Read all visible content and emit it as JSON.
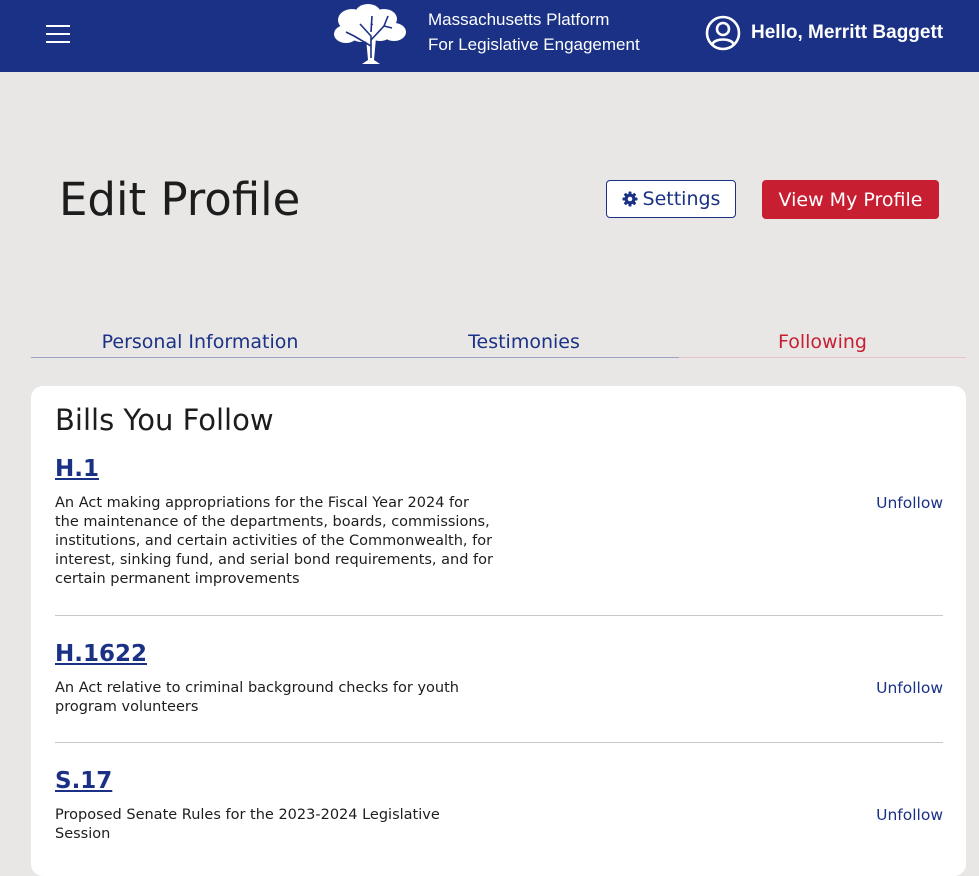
{
  "header": {
    "platform_line1": "Massachusetts Platform",
    "platform_line2": "For Legislative Engagement",
    "greeting": "Hello, Merritt Baggett",
    "menu_icon": "hamburger-menu-icon",
    "user_icon": "user-circle-icon",
    "logo_icon": "tree-logo-icon"
  },
  "page": {
    "title": "Edit Profile",
    "settings_label": "Settings",
    "settings_icon": "gear-icon",
    "view_profile_label": "View My Profile"
  },
  "tabs": [
    {
      "label": "Personal Information",
      "active": false
    },
    {
      "label": "Testimonies",
      "active": false
    },
    {
      "label": "Following",
      "active": true
    }
  ],
  "following": {
    "title": "Bills You Follow",
    "bills": [
      {
        "id": "H.1",
        "description": "An Act making appropriations for the Fiscal Year 2024 for the maintenance of the departments, boards, commissions, institutions, and certain activities of the Commonwealth, for interest, sinking fund, and serial bond requirements, and for certain permanent improvements",
        "action": "Unfollow"
      },
      {
        "id": "H.1622",
        "description": "An Act relative to criminal background checks for youth program volunteers",
        "action": "Unfollow"
      },
      {
        "id": "S.17",
        "description": "Proposed Senate Rules for the 2023-2024 Legislative Session",
        "action": "Unfollow"
      }
    ]
  },
  "colors": {
    "brand_navy": "#1a3185",
    "accent_red": "#c71e32",
    "background": "#e9e7e6"
  }
}
